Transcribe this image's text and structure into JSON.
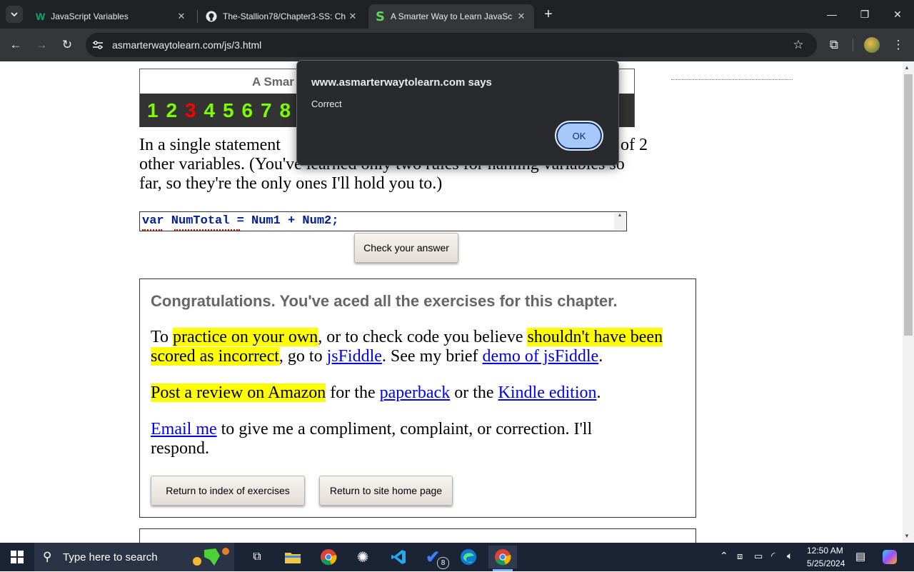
{
  "browser": {
    "tabs": [
      {
        "title": "JavaScript Variables",
        "icon": "w3schools-icon"
      },
      {
        "title": "The-Stallion78/Chapter3-SS: Ch",
        "icon": "github-icon"
      },
      {
        "title": "A Smarter Way to Learn JavaSc",
        "icon": "smarter-way-icon"
      }
    ],
    "url": "asmarterwaytolearn.com/js/3.html"
  },
  "page": {
    "header_title_partial": "A Smar",
    "chapter_numbers": [
      "1",
      "2",
      "3",
      "4",
      "5",
      "6",
      "7",
      "8"
    ],
    "current_chapter": "3",
    "trailing_number_partial": ")",
    "prompt_left": "In a single statement",
    "prompt_right": "of 2",
    "prompt_line2": "other variables. (You've learned only two rules for naming variables so",
    "prompt_line3": "far, so they're the only ones I'll hold you to.)",
    "answer_value": "var NumTotal = Num1 + Num2;",
    "check_button": "Check your answer",
    "congrats_heading": "Congratulations. You've aced all the exercises for this chapter.",
    "para1": {
      "t1": "To ",
      "h1": "practice on your own",
      "t2": ", or to check code you believe ",
      "h2": "shouldn't have been scored as incorrect",
      "t3": ", go to ",
      "l1": "jsFiddle",
      "t4": ". See my brief ",
      "l2": "demo of jsFiddle",
      "t5": "."
    },
    "para2": {
      "h1": "Post a review on Amazon",
      "t1": " for the ",
      "l1": "paperback",
      "t2": " or the ",
      "l2": "Kindle edition",
      "t3": "."
    },
    "para3": {
      "l1": "Email me",
      "t1": " to give me a compliment, complaint, or correction. I'll respond."
    },
    "btn_index": "Return to index of exercises",
    "btn_home": "Return to site home page"
  },
  "dialog": {
    "origin": "www.asmarterwaytolearn.com says",
    "message": "Correct",
    "ok": "OK"
  },
  "taskbar": {
    "search_placeholder": "Type here to search",
    "time": "12:50 AM",
    "date": "5/25/2024",
    "todo_badge": "8"
  },
  "colors": {
    "chapter_done": "#7cfc00",
    "chapter_current": "#ff0000",
    "highlight": "#ffff00",
    "link": "#0000ee"
  }
}
